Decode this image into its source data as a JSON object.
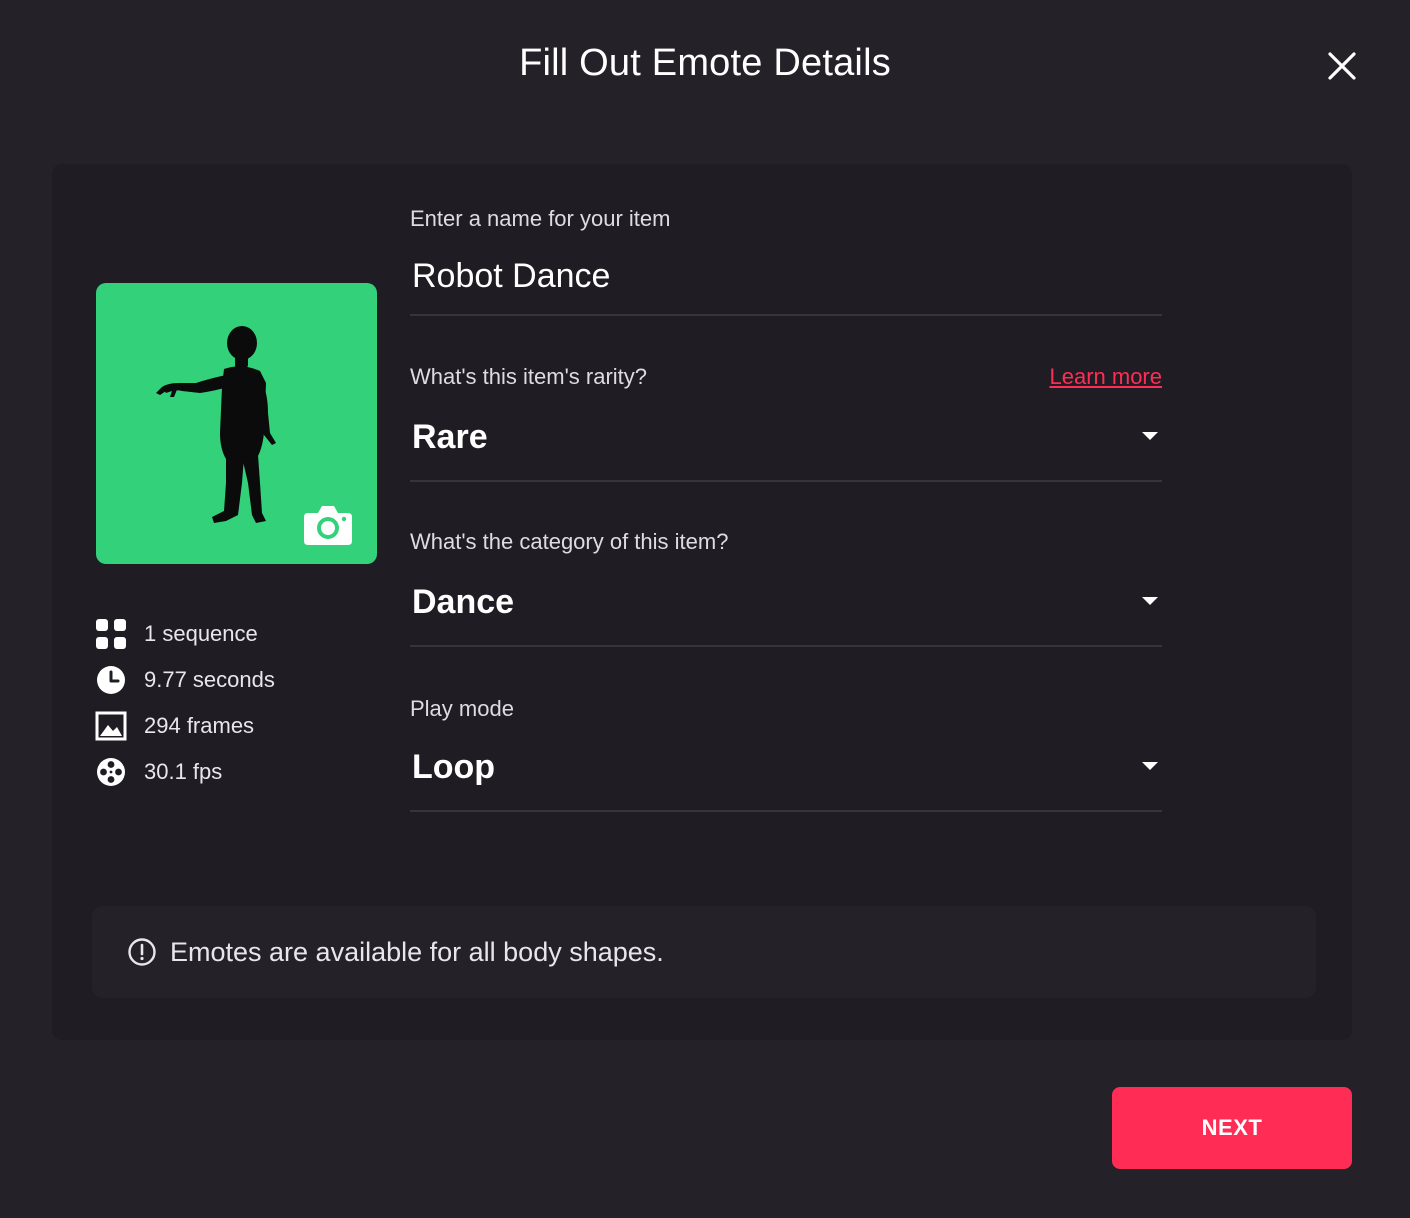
{
  "modal": {
    "title": "Fill Out Emote Details",
    "close_icon": "close-icon"
  },
  "thumbnail": {
    "background_color": "#33d17a",
    "figure": "avatar-silhouette",
    "camera_icon": "camera-icon"
  },
  "stats": [
    {
      "icon": "grid-icon",
      "text": "1 sequence"
    },
    {
      "icon": "clock-icon",
      "text": "9.77 seconds"
    },
    {
      "icon": "image-icon",
      "text": "294 frames"
    },
    {
      "icon": "film-reel-icon",
      "text": "30.1 fps"
    }
  ],
  "form": {
    "name": {
      "label": "Enter a name for your item",
      "value": "Robot Dance"
    },
    "rarity": {
      "label": "What's this item's rarity?",
      "learn_more": "Learn more",
      "value": "Rare"
    },
    "category": {
      "label": "What's the category of this item?",
      "value": "Dance"
    },
    "play_mode": {
      "label": "Play mode",
      "value": "Loop"
    }
  },
  "info": {
    "icon": "info-icon",
    "text": "Emotes are available for all body shapes."
  },
  "footer": {
    "next_label": "NEXT"
  },
  "colors": {
    "background": "#242129",
    "card": "#1f1d23",
    "accent": "#ff2d55",
    "thumbnail": "#33d17a"
  }
}
